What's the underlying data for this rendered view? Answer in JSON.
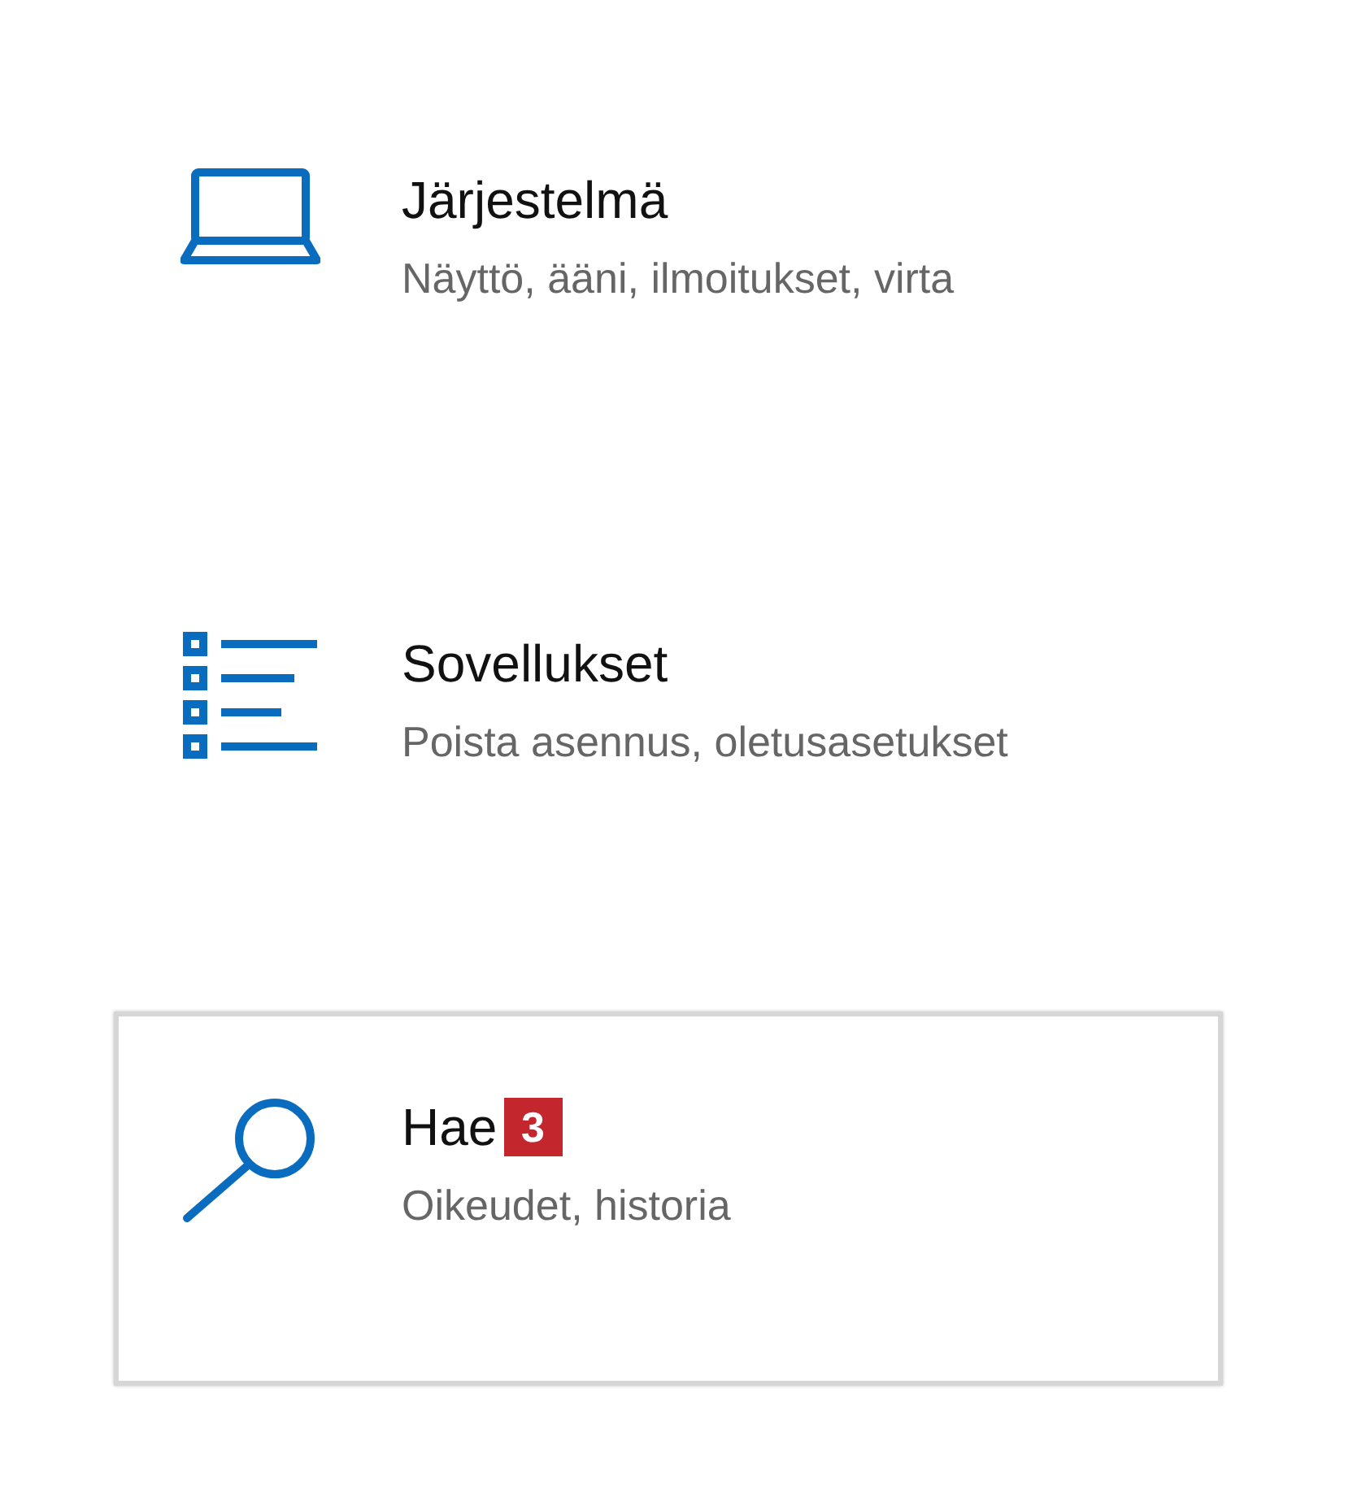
{
  "items": [
    {
      "kind": "system",
      "title": "Järjestelmä",
      "subtitle": "Näyttö, ääni, ilmoitukset, virta",
      "selected": false
    },
    {
      "kind": "apps",
      "title": "Sovellukset",
      "subtitle": "Poista asennus, oletusasetukset",
      "selected": false
    },
    {
      "kind": "search",
      "title": "Hae",
      "badge": "3",
      "subtitle": "Oikeudet, historia",
      "selected": true
    }
  ]
}
